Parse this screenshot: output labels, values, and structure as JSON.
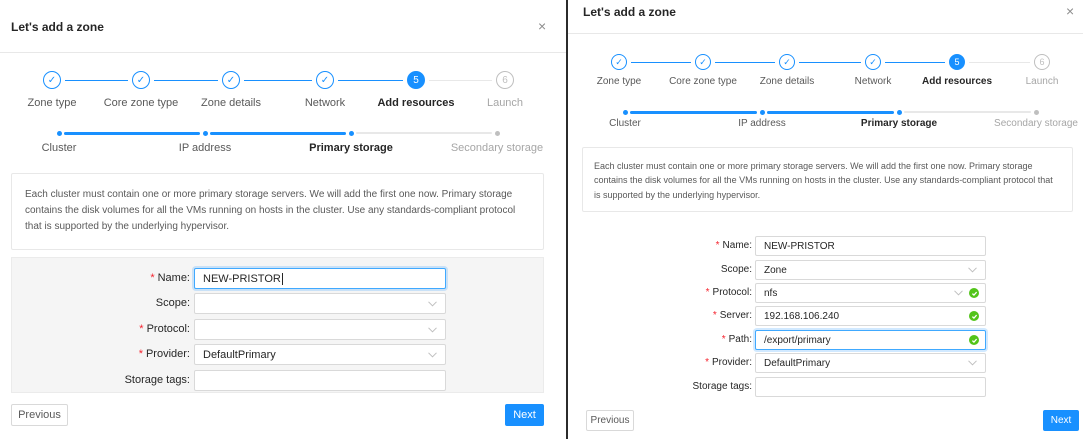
{
  "left": {
    "title": "Let's add a zone",
    "close": "×",
    "steps": [
      {
        "label": "Zone type",
        "state": "done",
        "glyph": "✓"
      },
      {
        "label": "Core zone type",
        "state": "done",
        "glyph": "✓"
      },
      {
        "label": "Zone details",
        "state": "done",
        "glyph": "✓"
      },
      {
        "label": "Network",
        "state": "done",
        "glyph": "✓"
      },
      {
        "label": "Add resources",
        "state": "active",
        "glyph": "5"
      },
      {
        "label": "Launch",
        "state": "wait",
        "glyph": "6"
      }
    ],
    "substeps": [
      {
        "label": "Cluster",
        "state": "done"
      },
      {
        "label": "IP address",
        "state": "done"
      },
      {
        "label": "Primary storage",
        "state": "active"
      },
      {
        "label": "Secondary storage",
        "state": "wait"
      }
    ],
    "description": "Each cluster must contain one or more primary storage servers. We will add the first one now. Primary storage contains the disk volumes for all the VMs running on hosts in the cluster. Use any standards-compliant protocol that is supported by the underlying hypervisor.",
    "fields": [
      {
        "label": "Name:",
        "required": true,
        "value": "NEW-PRISTOR",
        "type": "text",
        "focus": true
      },
      {
        "label": "Scope:",
        "required": false,
        "value": "",
        "type": "select"
      },
      {
        "label": "Protocol:",
        "required": true,
        "value": "",
        "type": "select"
      },
      {
        "label": "Provider:",
        "required": true,
        "value": "DefaultPrimary",
        "type": "select"
      },
      {
        "label": "Storage tags:",
        "required": false,
        "value": "",
        "type": "text"
      }
    ],
    "previous_label": "Previous",
    "next_label": "Next"
  },
  "right": {
    "title": "Let's add a zone",
    "close": "×",
    "steps": [
      {
        "label": "Zone type",
        "state": "done",
        "glyph": "✓"
      },
      {
        "label": "Core zone type",
        "state": "done",
        "glyph": "✓"
      },
      {
        "label": "Zone details",
        "state": "done",
        "glyph": "✓"
      },
      {
        "label": "Network",
        "state": "done",
        "glyph": "✓"
      },
      {
        "label": "Add resources",
        "state": "active",
        "glyph": "5"
      },
      {
        "label": "Launch",
        "state": "wait",
        "glyph": "6"
      }
    ],
    "substeps": [
      {
        "label": "Cluster",
        "state": "done"
      },
      {
        "label": "IP address",
        "state": "done"
      },
      {
        "label": "Primary storage",
        "state": "active"
      },
      {
        "label": "Secondary storage",
        "state": "wait"
      }
    ],
    "description": "Each cluster must contain one or more primary storage servers. We will add the first one now. Primary storage contains the disk volumes for all the VMs running on hosts in the cluster. Use any standards-compliant protocol that is supported by the underlying hypervisor.",
    "fields": [
      {
        "label": "Name:",
        "required": true,
        "value": "NEW-PRISTOR",
        "type": "text"
      },
      {
        "label": "Scope:",
        "required": false,
        "value": "Zone",
        "type": "select"
      },
      {
        "label": "Protocol:",
        "required": true,
        "value": "nfs",
        "type": "select",
        "valid": true
      },
      {
        "label": "Server:",
        "required": true,
        "value": "192.168.106.240",
        "type": "text",
        "valid": true
      },
      {
        "label": "Path:",
        "required": true,
        "value": "/export/primary",
        "type": "text",
        "valid": true,
        "focus": true
      },
      {
        "label": "Provider:",
        "required": true,
        "value": "DefaultPrimary",
        "type": "select"
      },
      {
        "label": "Storage tags:",
        "required": false,
        "value": "",
        "type": "text"
      }
    ],
    "previous_label": "Previous",
    "next_label": "Next"
  },
  "icons": {
    "check": "check-icon",
    "chevron": "chevron-down-icon",
    "valid": "check-circle-icon",
    "close": "close-icon"
  },
  "colors": {
    "primary": "#1890ff",
    "success": "#52c41a",
    "required": "#f5222d"
  }
}
